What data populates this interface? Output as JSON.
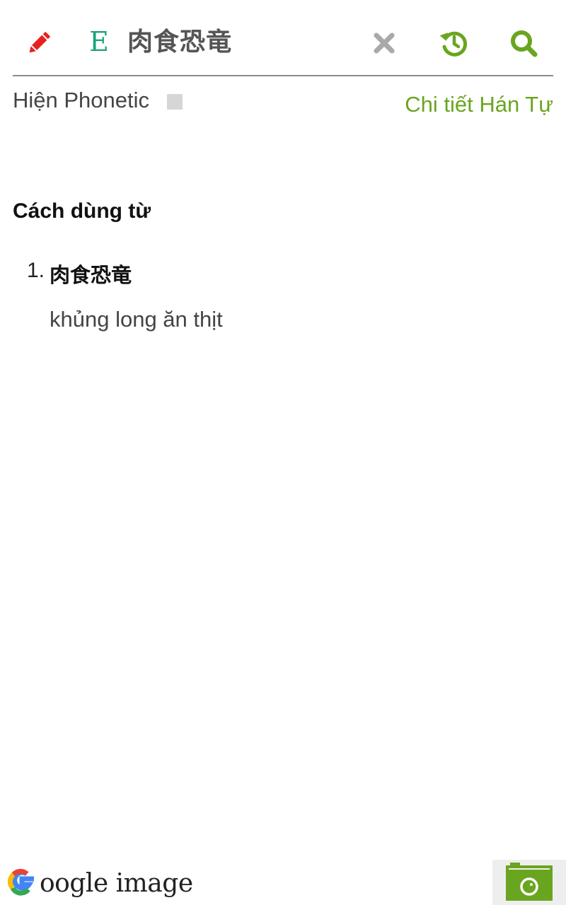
{
  "search_bar": {
    "language_label": "E",
    "query": "肉食恐竜",
    "icons": {
      "edit": "pencil-icon",
      "clear": "close-icon",
      "history": "history-icon",
      "search": "search-icon"
    }
  },
  "options": {
    "phonetic_label": "Hiện Phonetic",
    "kanji_detail_link": "Chi tiết Hán Tự"
  },
  "usage": {
    "title": "Cách dùng từ",
    "items": [
      {
        "number": "1.",
        "word": "肉食恐竜",
        "meaning": "khủng long ăn thịt"
      }
    ]
  },
  "bottom": {
    "google_image_label": "oogle image",
    "icons": {
      "google": "google-logo-icon",
      "camera": "camera-icon"
    }
  },
  "colors": {
    "accent_green": "#6aa51f",
    "edit_red": "#e8201f",
    "lang_teal": "#1aa37a",
    "clear_gray": "#a9a9a9"
  }
}
